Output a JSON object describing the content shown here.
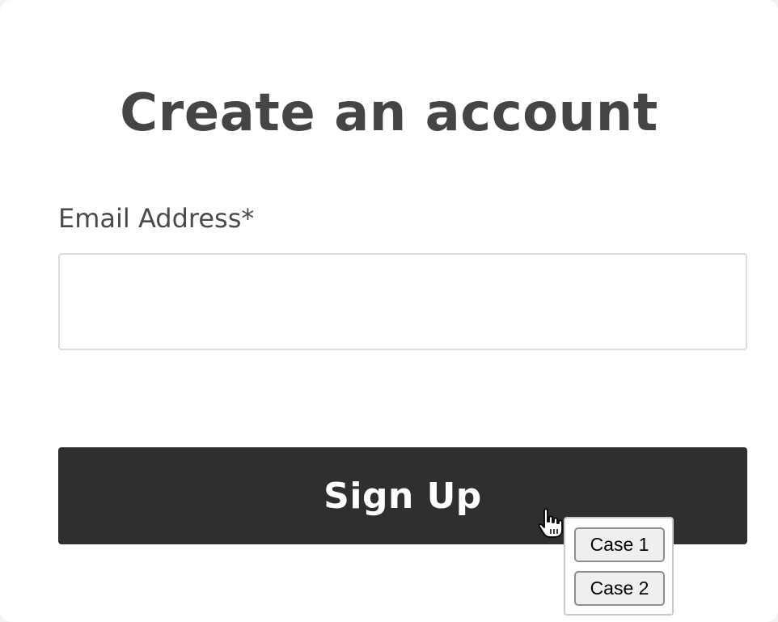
{
  "signup_form": {
    "title": "Create an account",
    "email_label": "Email Address*",
    "email_value": "",
    "email_placeholder": "",
    "submit_label": "Sign Up"
  },
  "cursor": {
    "icon": "hand-pointer-icon"
  },
  "case_popup": {
    "buttons": [
      "Case 1",
      "Case 2"
    ]
  },
  "colors": {
    "title": "#454545",
    "label": "#4a4a4a",
    "button_bg": "#2f2f2f",
    "button_text": "#ffffff",
    "input_border": "#dcdcdc"
  }
}
